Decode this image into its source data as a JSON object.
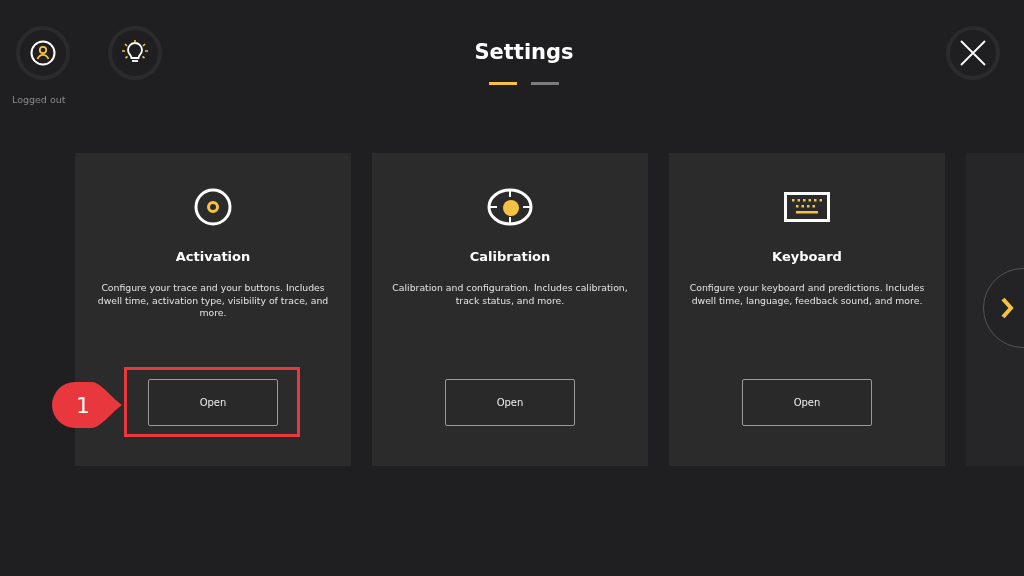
{
  "header": {
    "user_status": "Logged out",
    "title": "Settings"
  },
  "pages": [
    {
      "selected": true
    },
    {
      "selected": false
    }
  ],
  "cards": [
    {
      "kind": "target",
      "title": "Activation",
      "description": "Configure your trace and your buttons. Includes dwell time, activation type, visibility of trace, and more.",
      "button": "Open",
      "highlighted": true
    },
    {
      "kind": "calibration",
      "title": "Calibration",
      "description": "Calibration and configuration. Includes calibration, track status, and more.",
      "button": "Open",
      "highlighted": false
    },
    {
      "kind": "keyboard",
      "title": "Keyboard",
      "description": "Configure your keyboard and predictions. Includes dwell time, language, feedback sound, and more.",
      "button": "Open",
      "highlighted": false
    }
  ],
  "next_card_peek": true,
  "callout": {
    "label": "1"
  }
}
